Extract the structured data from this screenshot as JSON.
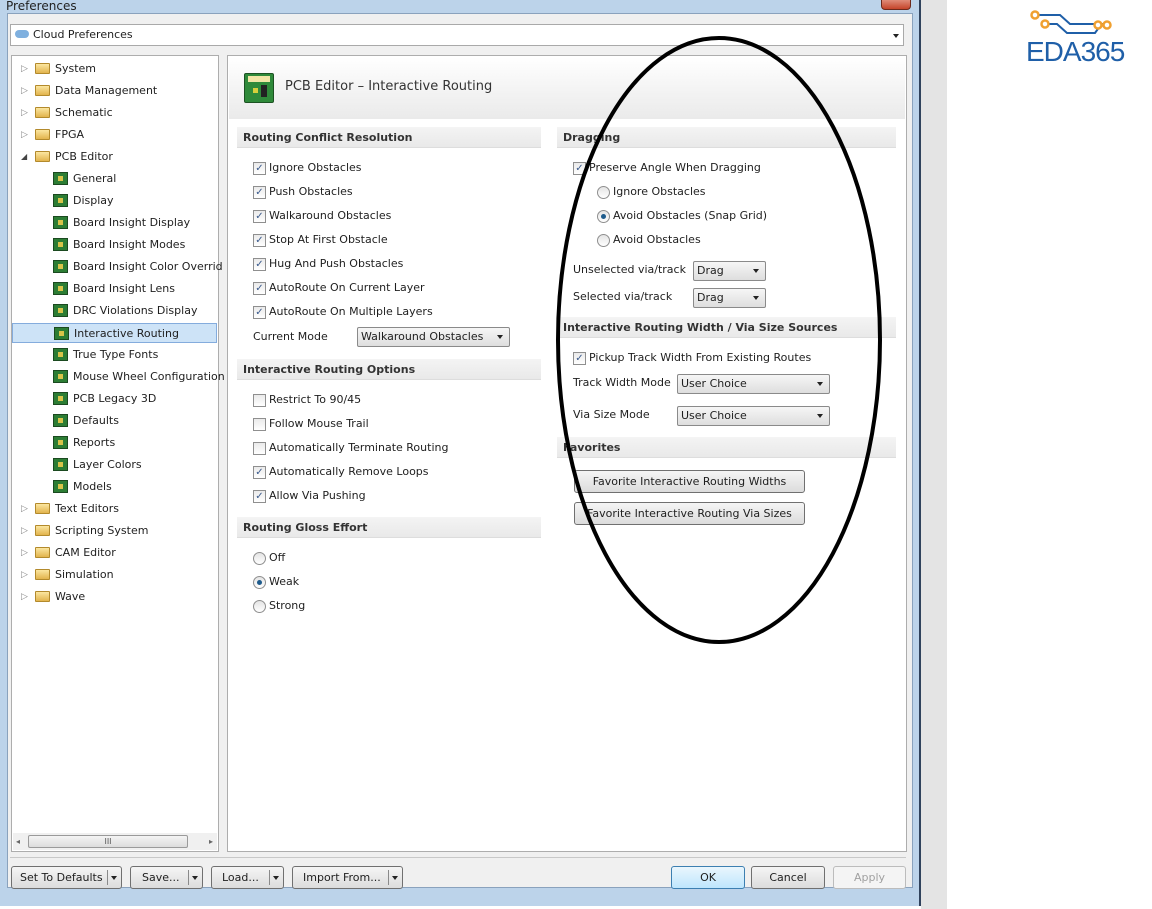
{
  "window": {
    "title": "Preferences"
  },
  "cloud_combo": {
    "label": "Cloud Preferences"
  },
  "tree": {
    "items": [
      {
        "label": "System",
        "level": 0
      },
      {
        "label": "Data Management",
        "level": 0
      },
      {
        "label": "Schematic",
        "level": 0
      },
      {
        "label": "FPGA",
        "level": 0
      },
      {
        "label": "PCB Editor",
        "level": 0,
        "expanded": true
      },
      {
        "label": "General",
        "level": 1
      },
      {
        "label": "Display",
        "level": 1
      },
      {
        "label": "Board Insight Display",
        "level": 1
      },
      {
        "label": "Board Insight Modes",
        "level": 1
      },
      {
        "label": "Board Insight Color Overrid",
        "level": 1
      },
      {
        "label": "Board Insight Lens",
        "level": 1
      },
      {
        "label": "DRC Violations Display",
        "level": 1
      },
      {
        "label": "Interactive Routing",
        "level": 1,
        "selected": true
      },
      {
        "label": "True Type Fonts",
        "level": 1
      },
      {
        "label": "Mouse Wheel Configuration",
        "level": 1
      },
      {
        "label": "PCB Legacy 3D",
        "level": 1
      },
      {
        "label": "Defaults",
        "level": 1
      },
      {
        "label": "Reports",
        "level": 1
      },
      {
        "label": "Layer Colors",
        "level": 1
      },
      {
        "label": "Models",
        "level": 1
      },
      {
        "label": "Text Editors",
        "level": 0
      },
      {
        "label": "Scripting System",
        "level": 0
      },
      {
        "label": "CAM Editor",
        "level": 0
      },
      {
        "label": "Simulation",
        "level": 0
      },
      {
        "label": "Wave",
        "level": 0
      }
    ],
    "scroll_thumb": "III"
  },
  "page": {
    "title": "PCB Editor – Interactive Routing"
  },
  "conflict": {
    "title": "Routing Conflict Resolution",
    "options": [
      {
        "label": "Ignore Obstacles",
        "checked": true
      },
      {
        "label": "Push Obstacles",
        "checked": true
      },
      {
        "label": "Walkaround Obstacles",
        "checked": true
      },
      {
        "label": "Stop At First Obstacle",
        "checked": true
      },
      {
        "label": "Hug And Push Obstacles",
        "checked": true
      },
      {
        "label": "AutoRoute On Current Layer",
        "checked": true
      },
      {
        "label": "AutoRoute On Multiple Layers",
        "checked": true
      }
    ],
    "mode_label": "Current Mode",
    "mode_value": "Walkaround Obstacles"
  },
  "options": {
    "title": "Interactive Routing Options",
    "items": [
      {
        "label": "Restrict To 90/45",
        "checked": false
      },
      {
        "label": "Follow Mouse Trail",
        "checked": false
      },
      {
        "label": "Automatically Terminate Routing",
        "checked": false
      },
      {
        "label": "Automatically Remove Loops",
        "checked": true
      },
      {
        "label": "Allow Via Pushing",
        "checked": true
      }
    ]
  },
  "gloss": {
    "title": "Routing Gloss Effort",
    "items": [
      {
        "label": "Off",
        "selected": false
      },
      {
        "label": "Weak",
        "selected": true
      },
      {
        "label": "Strong",
        "selected": false
      }
    ]
  },
  "dragging": {
    "title": "Dragging",
    "preserve_label": "Preserve Angle When Dragging",
    "preserve_checked": true,
    "radios": [
      {
        "label": "Ignore Obstacles",
        "selected": false
      },
      {
        "label": "Avoid Obstacles (Snap Grid)",
        "selected": true
      },
      {
        "label": "Avoid Obstacles",
        "selected": false
      }
    ],
    "unselected_label": "Unselected via/track",
    "unselected_value": "Drag",
    "selected_label": "Selected via/track",
    "selected_value": "Drag"
  },
  "width": {
    "title": "Interactive Routing Width / Via Size Sources",
    "pickup_label": "Pickup Track Width From Existing Routes",
    "pickup_checked": true,
    "track_label": "Track Width Mode",
    "track_value": "User Choice",
    "via_label": "Via Size Mode",
    "via_value": "User Choice"
  },
  "favorites": {
    "title": "Favorites",
    "widths_btn": "Favorite Interactive Routing Widths",
    "vias_btn": "Favorite Interactive Routing Via Sizes"
  },
  "footer": {
    "defaults": "Set To Defaults",
    "save": "Save...",
    "load": "Load...",
    "import": "Import From...",
    "ok": "OK",
    "cancel": "Cancel",
    "apply": "Apply"
  },
  "logo": {
    "text": "EDA365"
  },
  "colors": {
    "logo_blue": "#1f5fa8",
    "logo_orange": "#f0a030",
    "annotation": "#000000"
  }
}
